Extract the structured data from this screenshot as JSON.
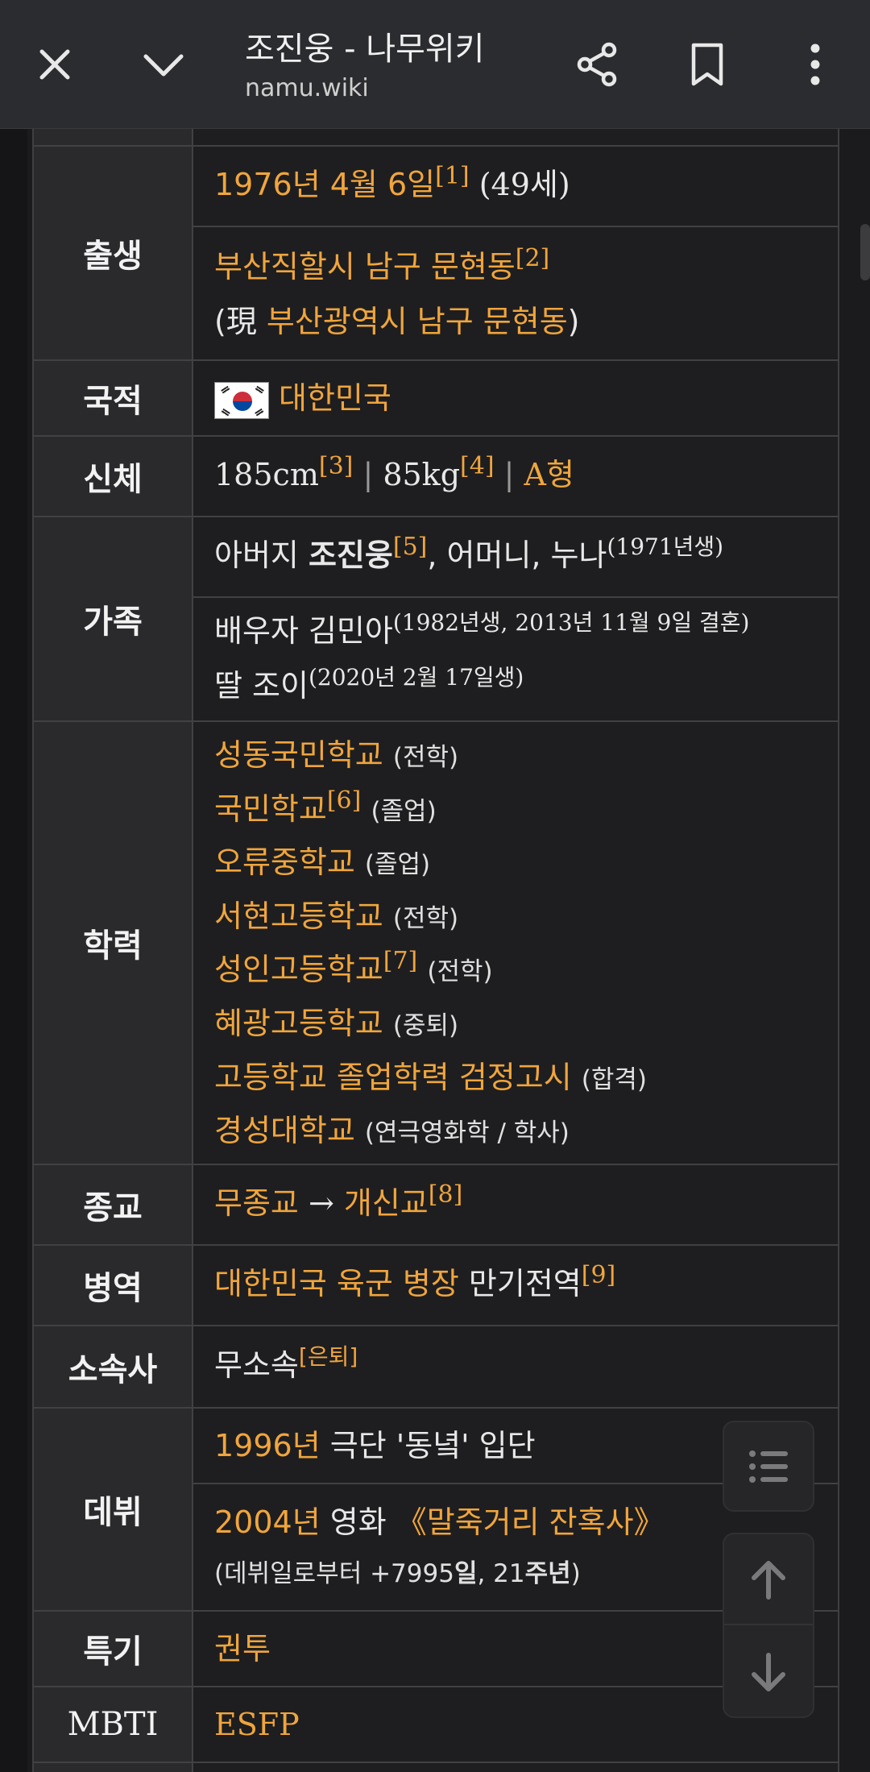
{
  "appbar": {
    "title": "조진웅 - 나무위키",
    "url": "namu.wiki",
    "close_icon": "close-icon",
    "collapse_icon": "chevron-down-icon",
    "share_icon": "share-icon",
    "bookmark_icon": "bookmark-icon",
    "menu_icon": "more-vert-icon"
  },
  "infobox": {
    "birth": {
      "label": "출생",
      "date": "1976년 4월 6일",
      "date_note": "[1]",
      "age": "(49세)",
      "place": "부산직할시 남구 문현동",
      "place_note": "[2]",
      "now_prefix": "(現 ",
      "now_place": "부산광역시 남구 문현동",
      "now_suffix": ")"
    },
    "nationality": {
      "label": "국적",
      "value": "대한민국"
    },
    "body": {
      "label": "신체",
      "height": "185cm",
      "height_note": "[3]",
      "sep1": " | ",
      "weight": "85kg",
      "weight_note": "[4]",
      "sep2": " | ",
      "blood": "A형"
    },
    "family": {
      "label": "가족",
      "father_prefix": "아버지 ",
      "father_name": "조진웅",
      "father_note": "[5]",
      "others": ", 어머니, 누나",
      "sister_note": "(1971년생)",
      "spouse": "배우자 김민아",
      "spouse_note": "(1982년생, 2013년 11월 9일 결혼)",
      "daughter": "딸 조이",
      "daughter_note": "(2020년 2월 17일생)"
    },
    "education": {
      "label": "학력",
      "items": [
        {
          "school": "성동국민학교",
          "note": "",
          "status": "(전학)"
        },
        {
          "school": "국민학교",
          "note": "[6]",
          "status": "(졸업)"
        },
        {
          "school": "오류중학교",
          "note": "",
          "status": "(졸업)"
        },
        {
          "school": "서현고등학교",
          "note": "",
          "status": "(전학)"
        },
        {
          "school": "성인고등학교",
          "note": "[7]",
          "status": "(전학)"
        },
        {
          "school": "혜광고등학교",
          "note": "",
          "status": "(중퇴)"
        },
        {
          "school": "고등학교 졸업학력 검정고시",
          "note": "",
          "status": "(합격)"
        },
        {
          "school": "경성대학교",
          "note": "",
          "status": "(연극영화학 / 학사)"
        }
      ]
    },
    "religion": {
      "label": "종교",
      "from": "무종교",
      "arrow": " → ",
      "to": "개신교",
      "note": "[8]"
    },
    "military": {
      "label": "병역",
      "branch": "대한민국 육군 병장",
      "status": " 만기전역",
      "note": "[9]"
    },
    "agency": {
      "label": "소속사",
      "value": "무소속",
      "note": "[은퇴]"
    },
    "debut": {
      "label": "데뷔",
      "stage_year": "1996년",
      "stage_text": " 극단 '동녘' 입단",
      "film_year": "2004년",
      "film_prefix": " 영화 ",
      "film_title": "《말죽거리 잔혹사》",
      "since_prefix": "(데뷔일로부터 +7995",
      "since_day": "일",
      "since_mid": ", 21",
      "since_year": "주년",
      "since_suffix": ")"
    },
    "specialty": {
      "label": "특기",
      "value": "권투"
    },
    "mbti": {
      "label": "MBTI",
      "value": "ESFP"
    }
  },
  "floating": {
    "toc_icon": "list-icon",
    "up_icon": "arrow-up-icon",
    "down_icon": "arrow-down-icon"
  },
  "colors": {
    "link": "#f0a53c",
    "appbar_bg": "#2b2c2f",
    "label_bg": "#2a2a2d",
    "value_bg": "#1e1e20"
  }
}
